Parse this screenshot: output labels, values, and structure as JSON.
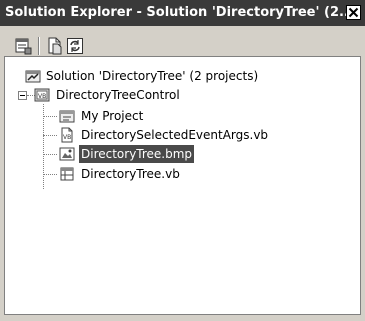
{
  "window": {
    "title": "Solution Explorer - Solution 'DirectoryTree' (2...",
    "title_bar_color": "#3a3a3a",
    "selection_color": "#4a4a4a"
  },
  "toolbar": {
    "buttons": [
      {
        "icon": "properties-icon"
      },
      {
        "icon": "show-all-files-icon"
      },
      {
        "icon": "refresh-icon"
      }
    ]
  },
  "tree": {
    "solution": {
      "label": "Solution 'DirectoryTree' (2 projects)",
      "icon": "solution-icon"
    },
    "project": {
      "label": "DirectoryTreeControl",
      "icon": "vb-project-icon",
      "expanded": true
    },
    "items": [
      {
        "label": "My Project",
        "icon": "my-project-icon",
        "selected": false
      },
      {
        "label": "DirectorySelectedEventArgs.vb",
        "icon": "vb-file-icon",
        "selected": false
      },
      {
        "label": "DirectoryTree.bmp",
        "icon": "bitmap-icon",
        "selected": true
      },
      {
        "label": "DirectoryTree.vb",
        "icon": "component-icon",
        "selected": false
      }
    ]
  }
}
